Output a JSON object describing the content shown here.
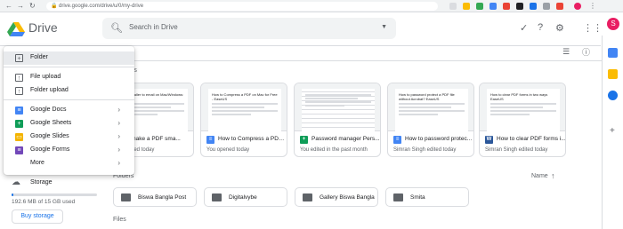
{
  "browser": {
    "url": "drive.google.com/drive/u/0/my-drive"
  },
  "app": {
    "title": "Drive",
    "brand_colors": [
      "#1a73e8",
      "#34a853",
      "#fbbc04",
      "#ea4335"
    ]
  },
  "search": {
    "placeholder": "Search in Drive"
  },
  "user": {
    "initial": "S"
  },
  "main": {
    "title_partial": "e",
    "section_quick": "ess",
    "section_folders": "Folders",
    "section_files": "Files",
    "sort_label": "Name"
  },
  "cards": [
    {
      "doc_title": "a PDF smaller to email on Mac/Windows: EaseUS",
      "name": "to make a PDF sma...",
      "subtitle": "ugh shared today",
      "type": "doc"
    },
    {
      "doc_title": "How to Compress a PDF on Mac for Free - EaseUS",
      "name": "How to Compress a PDF ...",
      "subtitle": "You opened today",
      "type": "doc"
    },
    {
      "doc_title": "",
      "name": "Password manager Pers...",
      "subtitle": "You edited in the past month",
      "type": "sheet"
    },
    {
      "doc_title": "How to password protect a PDF file without Acrobat? EaseUS",
      "name": "How to password protec...",
      "subtitle": "Simran Singh edited today",
      "type": "doc"
    },
    {
      "doc_title": "How to clear PDF forms in two ways EaseUS",
      "name": "How to clear PDF forms i...",
      "subtitle": "Simran Singh edited today",
      "type": "word"
    }
  ],
  "folders": [
    {
      "name": "Biswa Bangla Post"
    },
    {
      "name": "Digitalvybe"
    },
    {
      "name": "Gallery Biswa Bangla"
    },
    {
      "name": "Smita"
    }
  ],
  "sidebar": {
    "storage_label": "Storage",
    "storage_used": "192.6 MB of 15 GB used",
    "storage_fraction": 0.013,
    "buy_label": "Buy storage"
  },
  "menu": {
    "items": [
      {
        "label": "Folder",
        "icon": "new-folder-icon"
      },
      {
        "label": "File upload",
        "icon": "file-upload-icon"
      },
      {
        "label": "Folder upload",
        "icon": "folder-upload-icon"
      },
      {
        "label": "Google Docs",
        "icon": "docs-icon",
        "color": "#4285f4"
      },
      {
        "label": "Google Sheets",
        "icon": "sheets-icon",
        "color": "#0f9d58"
      },
      {
        "label": "Google Slides",
        "icon": "slides-icon",
        "color": "#f4b400"
      },
      {
        "label": "Google Forms",
        "icon": "forms-icon",
        "color": "#7248b9"
      },
      {
        "label": "More",
        "icon": ""
      }
    ]
  }
}
